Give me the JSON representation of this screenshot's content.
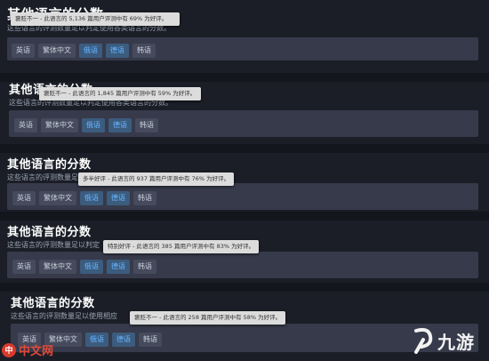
{
  "sections": [
    {
      "title": "其他语言的分数",
      "desc": "这些语言的评测数量足以判定使用各类语言的分数。",
      "tooltip": "褒贬不一 - 此语言的 5,136 篇用户评测中有 69% 为好评。",
      "chips": [
        "英语",
        "繁体中文",
        "俄语",
        "德语",
        "韩语"
      ]
    },
    {
      "title": "其他语言的分数",
      "desc": "这些语言的评测数量足以判定使用各类语言的分数。",
      "tooltip": "褒贬不一 - 此语言的 1,845 篇用户评测中有 59% 为好评。",
      "chips": [
        "英语",
        "繁体中文",
        "俄语",
        "德语",
        "韩语"
      ]
    },
    {
      "title": "其他语言的分数",
      "desc": "这些语言的评测数量足",
      "tooltip": "多半好评 - 此语言的 937 篇用户评测中有 76% 为好评。",
      "chips": [
        "英语",
        "繁体中文",
        "俄语",
        "德语",
        "韩语"
      ]
    },
    {
      "title": "其他语言的分数",
      "desc": "这些语言的评测数量足以判定",
      "tooltip": "特别好评 - 此语言的 385 篇用户评测中有 83% 为好评。",
      "chips": [
        "英语",
        "繁体中文",
        "俄语",
        "德语",
        "韩语"
      ]
    },
    {
      "title": "其他语言的分数",
      "desc": "这些语言的评测数量足以使用相应",
      "tooltip": "褒贬不一 - 此语言的 258 篇用户评测中有 58% 为好评。",
      "chips": [
        "英语",
        "繁体中文",
        "俄语",
        "德语",
        "韩语"
      ]
    }
  ],
  "watermarks": {
    "left_logo_char": "中",
    "left_logo_text": "中文网",
    "right_logo_text": "九游"
  },
  "colors": {
    "background": "#1b1e27",
    "bar": "#363a4a",
    "chip": "#454a5c",
    "chip_highlight_text": "#66b3ff"
  }
}
